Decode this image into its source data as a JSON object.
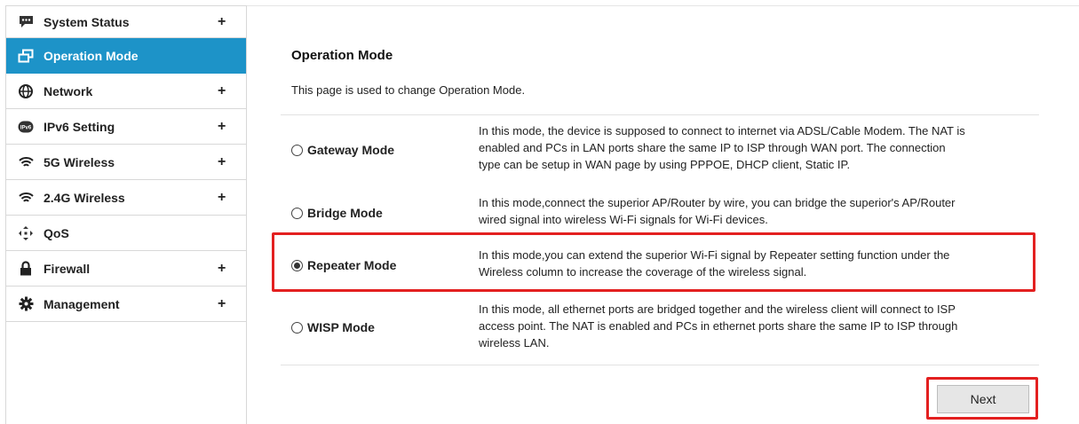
{
  "sidebar": {
    "items": [
      {
        "label": "System Status",
        "icon": "chat-bubble-icon",
        "expand": "+"
      },
      {
        "label": "Operation Mode",
        "icon": "windows-icon",
        "expand": ""
      },
      {
        "label": "Network",
        "icon": "globe-icon",
        "expand": "+"
      },
      {
        "label": "IPv6 Setting",
        "icon": "ipv6-icon",
        "expand": "+"
      },
      {
        "label": "5G Wireless",
        "icon": "wifi-icon",
        "expand": "+"
      },
      {
        "label": "2.4G Wireless",
        "icon": "wifi-icon",
        "expand": "+"
      },
      {
        "label": "QoS",
        "icon": "arrows-icon",
        "expand": ""
      },
      {
        "label": "Firewall",
        "icon": "lock-icon",
        "expand": "+"
      },
      {
        "label": "Management",
        "icon": "gear-icon",
        "expand": "+"
      }
    ],
    "active_index": 1,
    "active_color": "#1d93c8"
  },
  "main": {
    "title": "Operation Mode",
    "description": "This page is used to change Operation Mode.",
    "modes": [
      {
        "label": "Gateway Mode",
        "selected": false,
        "lines": [
          "In this mode, the device is supposed to connect to internet via ADSL/Cable Modem. The NAT is",
          "enabled and PCs in LAN ports share the same IP to ISP through WAN port. The connection",
          "type can be setup in WAN page by using PPPOE, DHCP client, Static IP."
        ]
      },
      {
        "label": "Bridge Mode",
        "selected": false,
        "lines": [
          "In this mode,connect the superior AP/Router by wire, you can bridge the superior's AP/Router",
          "wired signal into wireless Wi-Fi signals for Wi-Fi devices."
        ]
      },
      {
        "label": "Repeater Mode",
        "selected": true,
        "lines": [
          "In this mode,you can extend the superior Wi-Fi signal by Repeater setting function under the",
          "Wireless column to increase the coverage of the wireless signal."
        ]
      },
      {
        "label": "WISP Mode",
        "selected": false,
        "lines": [
          "In this mode, all ethernet ports are bridged together and the wireless client will connect to ISP",
          "access point. The NAT is enabled and PCs in ethernet ports share the same IP to ISP through",
          "wireless LAN."
        ]
      }
    ],
    "next_label": "Next",
    "highlight_color": "#e32020"
  }
}
